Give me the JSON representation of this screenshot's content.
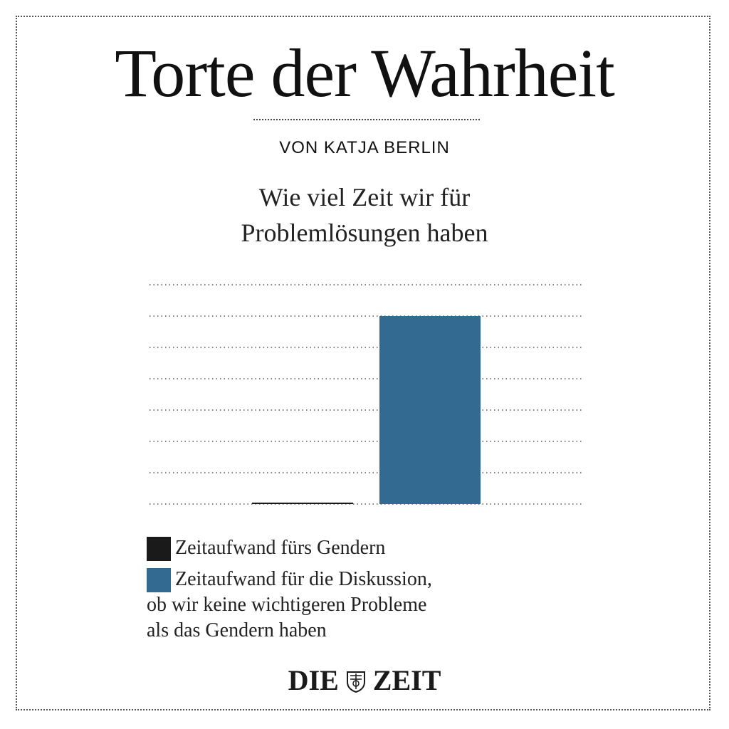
{
  "header": {
    "title": "Torte der Wahrheit",
    "byline": "VON KATJA BERLIN"
  },
  "chart_data": {
    "type": "bar",
    "title_lines": [
      "Wie viel Zeit wir für",
      "Problemlösungen haben"
    ],
    "categories": [
      "Zeitaufwand fürs Gendern",
      "Zeitaufwand für die Diskussion, ob wir keine wichtigeren Probleme als das Gendern haben"
    ],
    "values": [
      0,
      6
    ],
    "colors": [
      "#1a1a1a",
      "#336a91"
    ],
    "ylim": [
      0,
      7
    ],
    "grid": true,
    "xlabel": "",
    "ylabel": ""
  },
  "legend": {
    "items": [
      {
        "lines": [
          "Zeitaufwand fürs Gendern"
        ],
        "color": "#1a1a1a"
      },
      {
        "lines": [
          "Zeitaufwand für die Diskussion,",
          "ob wir keine wichtigeren Probleme",
          "als das Gendern haben"
        ],
        "color": "#336a91"
      }
    ]
  },
  "footer": {
    "logo_left": "DIE",
    "logo_right": "ZEIT"
  }
}
